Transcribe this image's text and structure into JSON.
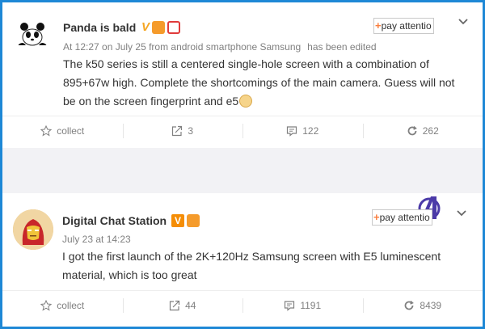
{
  "posts": [
    {
      "username": "Panda is bald",
      "meta_time": "At 12:27 on July 25 from android smartphone Samsung",
      "meta_edited": "has been edited",
      "content": "The k50 series is still a centered single-hole screen with a combination of 895+67w high. Complete the shortcomings of the main camera. Guess will not be on the screen fingerprint and e5",
      "follow_plus": "+",
      "follow_label": "pay attentio",
      "actions": {
        "collect": "collect",
        "repost_count": "3",
        "comment_count": "122",
        "like_count": "262"
      }
    },
    {
      "username": "Digital Chat Station",
      "meta_time": "July 23 at 14:23",
      "content": "I got the first launch of the 2K+120Hz Samsung screen with E5 luminescent material, which is too great",
      "follow_plus": "+",
      "follow_label": "pay attentio",
      "actions": {
        "collect": "collect",
        "repost_count": "44",
        "comment_count": "1191",
        "like_count": "8439"
      }
    }
  ],
  "colors": {
    "window_border": "#1e88d6",
    "follow_plus": "#fa7d3c",
    "badge_v": "#f5a623",
    "text": "#333333",
    "meta": "#808080"
  },
  "icons": {
    "collect": "star-icon",
    "repost": "share-icon",
    "comment": "comment-icon",
    "like": "refresh-icon",
    "menu": "chevron-down-icon"
  }
}
